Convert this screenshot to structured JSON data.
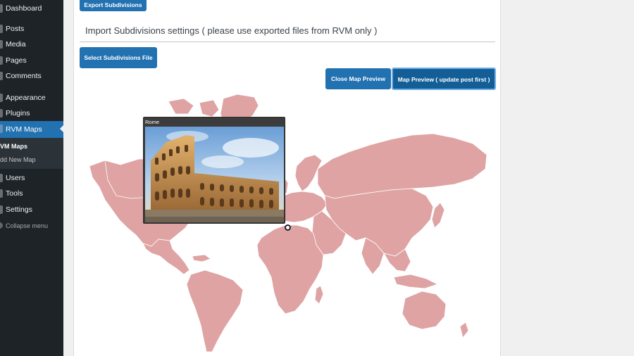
{
  "sidebar": {
    "items": [
      {
        "label": "Dashboard",
        "icon": "dashboard-icon"
      },
      {
        "label": "Posts",
        "icon": "pin-icon"
      },
      {
        "label": "Media",
        "icon": "media-icon"
      },
      {
        "label": "Pages",
        "icon": "pages-icon"
      },
      {
        "label": "Comments",
        "icon": "comments-icon"
      },
      {
        "label": "Appearance",
        "icon": "brush-icon"
      },
      {
        "label": "Plugins",
        "icon": "plugin-icon"
      },
      {
        "label": "RVM Maps",
        "icon": "map-icon",
        "active": true
      },
      {
        "label": "Users",
        "icon": "users-icon"
      },
      {
        "label": "Tools",
        "icon": "tools-icon"
      },
      {
        "label": "Settings",
        "icon": "settings-icon"
      }
    ],
    "submenu": {
      "current": "VM Maps",
      "other": "dd New Map"
    },
    "collapse_label": "Collapse menu"
  },
  "main": {
    "export_button": "Export Subdivisions",
    "import_heading": "Import Subdivisions settings ( please use exported files from RVM only )",
    "select_file_button": "Select Subdivisions File",
    "close_preview_button": "Close Map Preview",
    "map_preview_button": "Map Preview ( update post first )"
  },
  "map": {
    "region_color": "#dfa3a3",
    "border_color": "#ffffff",
    "tooltip": {
      "title": "Rome",
      "image": "colosseum"
    }
  },
  "colors": {
    "accent": "#2271b1",
    "sidebar_bg": "#1d2327"
  }
}
